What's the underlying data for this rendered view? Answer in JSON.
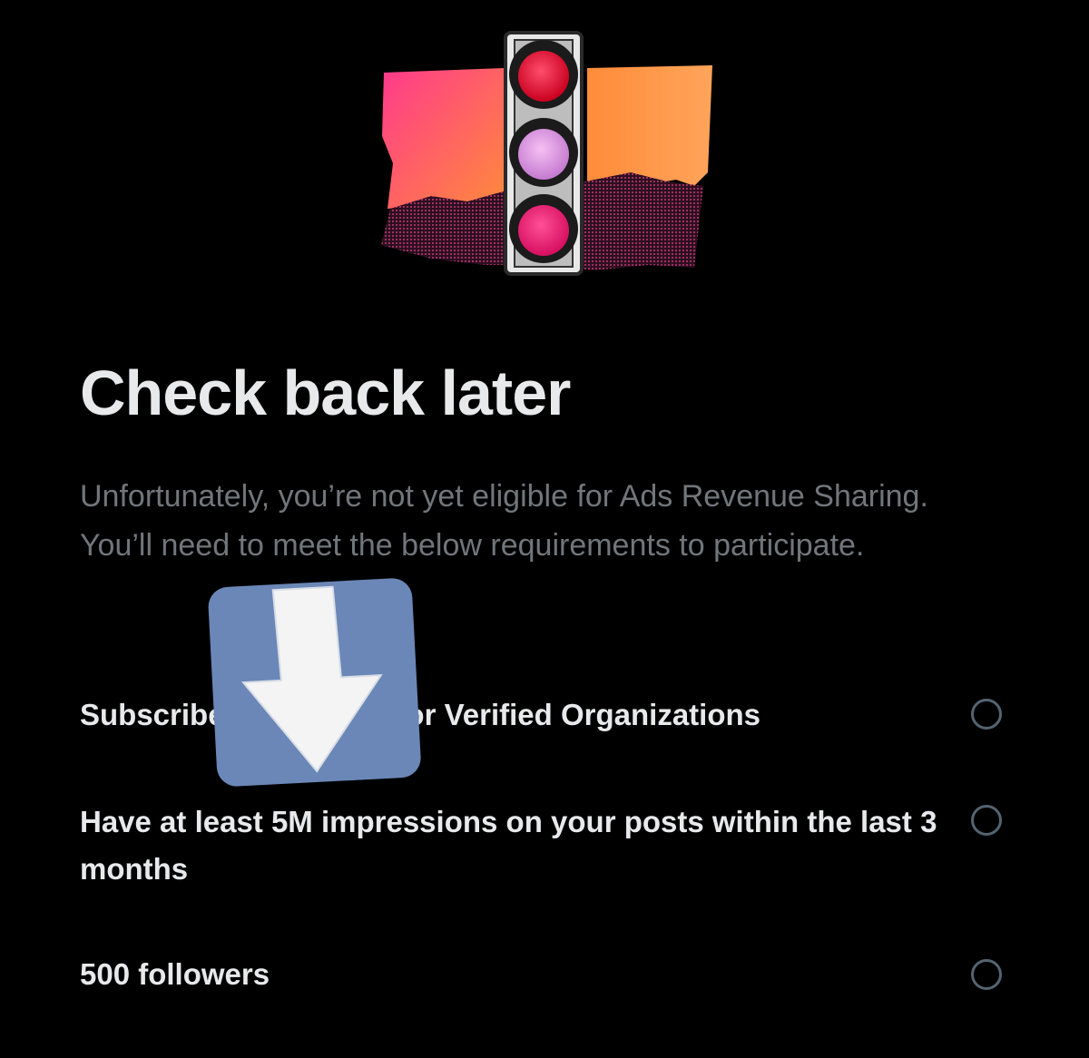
{
  "header": {
    "title": "Check back later",
    "description": "Unfortunately, you’re not yet eligible for Ads Revenue Sharing. You’ll need to meet the below requirements to participate."
  },
  "requirements": [
    {
      "label": "Subscribe to Premium or Verified Organizations",
      "checked": false
    },
    {
      "label": "Have at least 5M impressions on your posts within the last 3 months",
      "checked": false
    },
    {
      "label": "500 followers",
      "checked": false
    }
  ],
  "icons": {
    "hero": "traffic-light-illustration",
    "overlay": "down-arrow-icon",
    "radio": "empty-radio-circle-icon"
  },
  "colors": {
    "background": "#000000",
    "title": "#e7e9ea",
    "muted": "#71767b",
    "radio_border": "#536471",
    "overlay_tile": "#6a87b7"
  }
}
